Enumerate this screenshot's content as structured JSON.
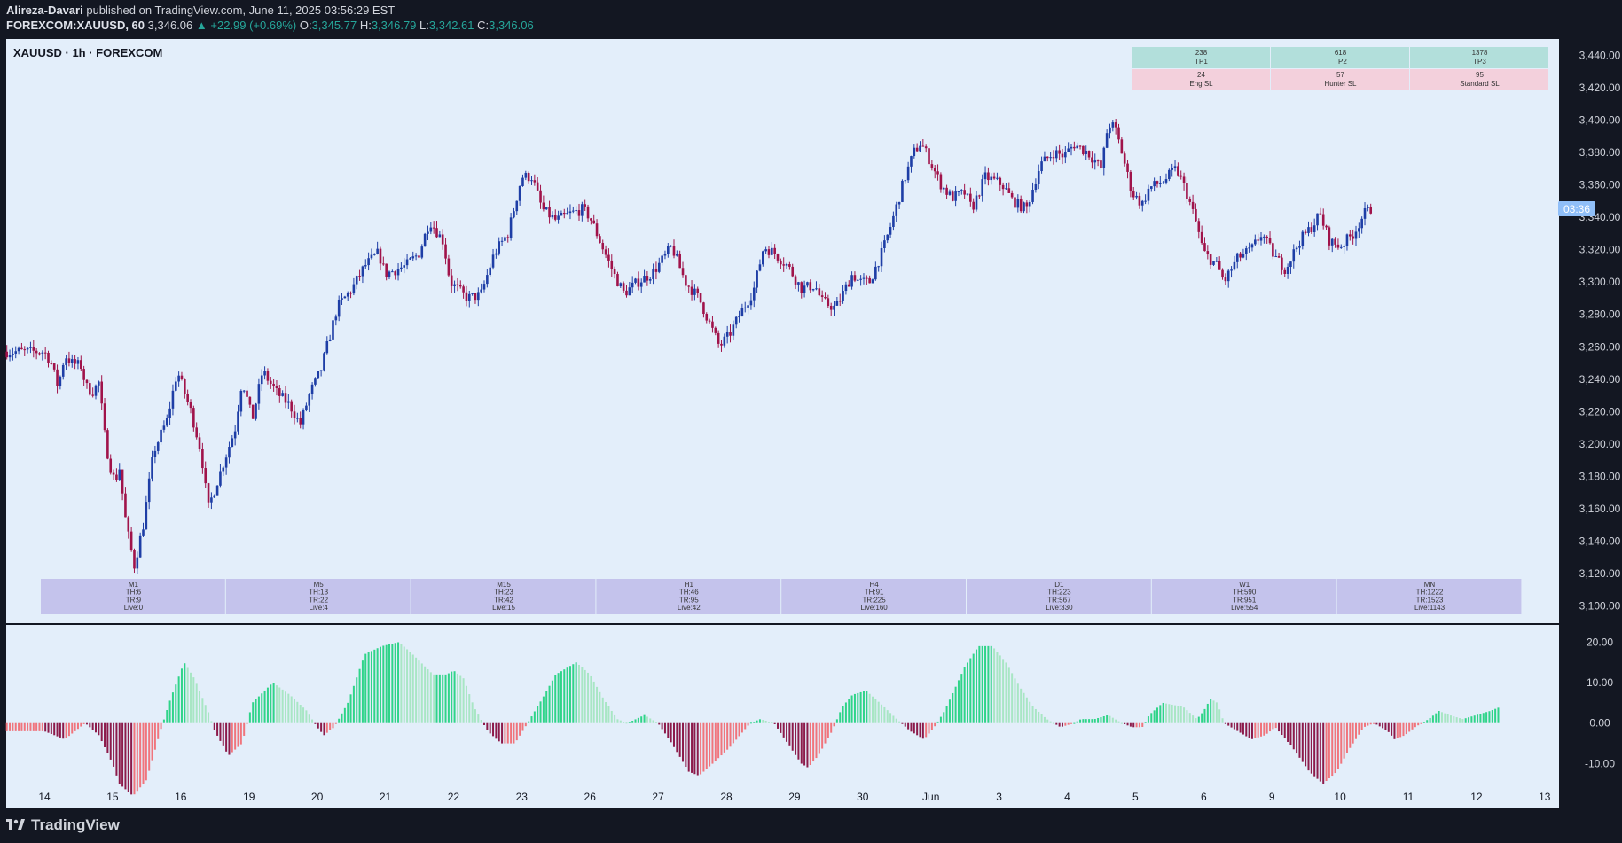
{
  "header": {
    "author": "Alireza-Davari",
    "published": "published on TradingView.com, June 11, 2025 03:56:29 EST",
    "symbol": "FOREXCOM:XAUUSD, 60",
    "last": "3,346.06",
    "change": "▲ +22.99 (+0.69%)",
    "o_label": "O:",
    "o": "3,345.77",
    "h_label": "H:",
    "h": "3,346.79",
    "l_label": "L:",
    "l": "3,342.61",
    "c_label": "C:",
    "c": "3,346.06"
  },
  "legend_title": "XAUUSD · 1h · FOREXCOM",
  "price_badge": "03:36",
  "footer": {
    "brand": "TradingView"
  },
  "colors": {
    "background": "#131722",
    "plot_bg": "#e3eefa",
    "candle_up": "#1e3ea6",
    "candle_down": "#a0134a",
    "osc_pos_strong": "#2fd489",
    "osc_pos_weak": "#a8e6c4",
    "osc_neg_strong": "#8c1a4a",
    "osc_neg_weak": "#f0747c",
    "tp_fill": "#b2dfdb",
    "sl_fill": "#f3d0dc",
    "tf_fill": "#c4c3ec",
    "badge": "#90bff9"
  },
  "tp_sl_table": {
    "tp": [
      {
        "value": "238",
        "label": "TP1"
      },
      {
        "value": "618",
        "label": "TP2"
      },
      {
        "value": "1378",
        "label": "TP3"
      }
    ],
    "sl": [
      {
        "value": "24",
        "label": "Eng SL"
      },
      {
        "value": "57",
        "label": "Hunter SL"
      },
      {
        "value": "95",
        "label": "Standard SL"
      }
    ]
  },
  "timeframe_table": [
    {
      "tf": "M1",
      "th": "TH:6",
      "tr": "TR:9",
      "live": "Live:0"
    },
    {
      "tf": "M5",
      "th": "TH:13",
      "tr": "TR:22",
      "live": "Live:4"
    },
    {
      "tf": "M15",
      "th": "TH:23",
      "tr": "TR:42",
      "live": "Live:15"
    },
    {
      "tf": "H1",
      "th": "TH:46",
      "tr": "TR:95",
      "live": "Live:42"
    },
    {
      "tf": "H4",
      "th": "TH:91",
      "tr": "TR:225",
      "live": "Live:160"
    },
    {
      "tf": "D1",
      "th": "TH:223",
      "tr": "TR:567",
      "live": "Live:330"
    },
    {
      "tf": "W1",
      "th": "TH:590",
      "tr": "TR:951",
      "live": "Live:554"
    },
    {
      "tf": "MN",
      "th": "TH:1222",
      "tr": "TR:1523",
      "live": "Live:1143"
    }
  ],
  "chart_data": [
    {
      "type": "candlestick",
      "title": "XAUUSD · 1h · FOREXCOM",
      "ylim": [
        3090,
        3450
      ],
      "y_ticks": [
        3100,
        3120,
        3140,
        3160,
        3180,
        3200,
        3220,
        3240,
        3260,
        3280,
        3300,
        3320,
        3340,
        3360,
        3380,
        3400,
        3420,
        3440
      ],
      "y_tick_labels": [
        "3,100.00",
        "3,120.00",
        "3,140.00",
        "3,160.00",
        "3,180.00",
        "3,200.00",
        "3,220.00",
        "3,240.00",
        "3,260.00",
        "3,280.00",
        "3,300.00",
        "3,320.00",
        "3,340.00",
        "3,360.00",
        "3,380.00",
        "3,400.00",
        "3,420.00",
        "3,440.00"
      ],
      "x_labels": [
        "14",
        "15",
        "16",
        "19",
        "20",
        "21",
        "22",
        "23",
        "26",
        "27",
        "28",
        "29",
        "30",
        "Jun",
        "3",
        "4",
        "5",
        "6",
        "9",
        "10",
        "11",
        "12",
        "13"
      ],
      "x_label_pos": [
        0,
        1,
        2,
        3,
        4,
        5,
        6,
        7,
        8,
        9,
        10,
        11,
        12,
        13,
        14,
        15,
        16,
        17,
        18,
        19,
        20,
        21,
        22
      ],
      "bar_count_span": 22.5,
      "x_start": -0.55,
      "close_path": [
        [
          0,
          3257
        ],
        [
          0.1,
          3250
        ],
        [
          0.2,
          3235
        ],
        [
          0.3,
          3255
        ],
        [
          0.4,
          3250
        ],
        [
          0.55,
          3248
        ],
        [
          0.6,
          3236
        ],
        [
          0.7,
          3232
        ],
        [
          0.8,
          3238
        ],
        [
          0.9,
          3200
        ],
        [
          1.0,
          3180
        ],
        [
          1.05,
          3178
        ],
        [
          1.1,
          3186
        ],
        [
          1.2,
          3150
        ],
        [
          1.32,
          3125
        ],
        [
          1.45,
          3150
        ],
        [
          1.6,
          3195
        ],
        [
          1.8,
          3215
        ],
        [
          1.95,
          3245
        ],
        [
          2.15,
          3220
        ],
        [
          2.3,
          3195
        ],
        [
          2.4,
          3160
        ],
        [
          2.6,
          3185
        ],
        [
          2.8,
          3210
        ],
        [
          2.9,
          3240
        ],
        [
          3.05,
          3215
        ],
        [
          3.2,
          3245
        ],
        [
          3.4,
          3232
        ],
        [
          3.6,
          3224
        ],
        [
          3.75,
          3212
        ],
        [
          3.9,
          3232
        ],
        [
          4.05,
          3245
        ],
        [
          4.3,
          3285
        ],
        [
          4.5,
          3295
        ],
        [
          4.7,
          3310
        ],
        [
          4.9,
          3318
        ],
        [
          5.0,
          3305
        ],
        [
          5.3,
          3310
        ],
        [
          5.5,
          3318
        ],
        [
          5.65,
          3338
        ],
        [
          5.85,
          3325
        ],
        [
          5.95,
          3300
        ],
        [
          6.2,
          3290
        ],
        [
          6.4,
          3292
        ],
        [
          6.6,
          3318
        ],
        [
          6.8,
          3330
        ],
        [
          7.0,
          3365
        ],
        [
          7.15,
          3365
        ],
        [
          7.3,
          3345
        ],
        [
          7.5,
          3338
        ],
        [
          7.7,
          3342
        ],
        [
          7.9,
          3345
        ],
        [
          8.0,
          3340
        ],
        [
          8.15,
          3325
        ],
        [
          8.35,
          3305
        ],
        [
          8.5,
          3293
        ],
        [
          8.7,
          3300
        ],
        [
          8.9,
          3305
        ],
        [
          9.0,
          3310
        ],
        [
          9.2,
          3322
        ],
        [
          9.4,
          3300
        ],
        [
          9.6,
          3290
        ],
        [
          9.8,
          3270
        ],
        [
          9.9,
          3260
        ],
        [
          10.05,
          3268
        ],
        [
          10.2,
          3280
        ],
        [
          10.4,
          3295
        ],
        [
          10.55,
          3322
        ],
        [
          10.7,
          3318
        ],
        [
          10.9,
          3310
        ],
        [
          11.1,
          3296
        ],
        [
          11.3,
          3298
        ],
        [
          11.4,
          3288
        ],
        [
          11.6,
          3284
        ],
        [
          11.7,
          3292
        ],
        [
          11.85,
          3305
        ],
        [
          11.95,
          3300
        ],
        [
          12.1,
          3300
        ],
        [
          12.3,
          3320
        ],
        [
          12.45,
          3340
        ],
        [
          12.6,
          3362
        ],
        [
          12.75,
          3380
        ],
        [
          12.85,
          3386
        ],
        [
          12.95,
          3378
        ],
        [
          13.15,
          3360
        ],
        [
          13.3,
          3352
        ],
        [
          13.5,
          3355
        ],
        [
          13.6,
          3345
        ],
        [
          13.8,
          3365
        ],
        [
          14.05,
          3360
        ],
        [
          14.2,
          3350
        ],
        [
          14.4,
          3345
        ],
        [
          14.6,
          3372
        ],
        [
          14.8,
          3380
        ],
        [
          14.95,
          3378
        ],
        [
          15.1,
          3385
        ],
        [
          15.3,
          3380
        ],
        [
          15.5,
          3370
        ],
        [
          15.6,
          3398
        ],
        [
          15.7,
          3395
        ],
        [
          15.8,
          3380
        ],
        [
          15.95,
          3355
        ],
        [
          16.1,
          3348
        ],
        [
          16.2,
          3358
        ],
        [
          16.4,
          3362
        ],
        [
          16.6,
          3370
        ],
        [
          16.75,
          3355
        ],
        [
          16.9,
          3335
        ],
        [
          17.0,
          3318
        ],
        [
          17.2,
          3310
        ],
        [
          17.3,
          3300
        ],
        [
          17.5,
          3315
        ],
        [
          17.7,
          3320
        ],
        [
          17.85,
          3330
        ],
        [
          18.05,
          3315
        ],
        [
          18.2,
          3308
        ],
        [
          18.4,
          3325
        ],
        [
          18.6,
          3335
        ],
        [
          18.7,
          3342
        ],
        [
          18.85,
          3325
        ],
        [
          19.0,
          3322
        ],
        [
          19.2,
          3330
        ],
        [
          19.35,
          3342
        ],
        [
          19.45,
          3345
        ]
      ]
    },
    {
      "type": "bar",
      "name": "oscillator",
      "ylim": [
        -18,
        24
      ],
      "y_ticks": [
        -10,
        0,
        10,
        20
      ],
      "y_tick_labels": [
        "-10.00",
        "0.00",
        "10.00",
        "20.00"
      ],
      "values_path": [
        [
          0,
          -2
        ],
        [
          0.3,
          -4
        ],
        [
          0.6,
          0
        ],
        [
          0.8,
          -3
        ],
        [
          1.0,
          -10
        ],
        [
          1.1,
          -15
        ],
        [
          1.3,
          -18
        ],
        [
          1.5,
          -14
        ],
        [
          1.7,
          -2
        ],
        [
          1.85,
          6
        ],
        [
          2.05,
          15
        ],
        [
          2.2,
          11
        ],
        [
          2.4,
          3
        ],
        [
          2.5,
          -2
        ],
        [
          2.7,
          -8
        ],
        [
          2.9,
          -5
        ],
        [
          3.05,
          5
        ],
        [
          3.35,
          10
        ],
        [
          3.6,
          7
        ],
        [
          3.85,
          3
        ],
        [
          4.0,
          -1
        ],
        [
          4.1,
          -3
        ],
        [
          4.25,
          -1
        ],
        [
          4.45,
          5
        ],
        [
          4.7,
          17
        ],
        [
          4.95,
          19
        ],
        [
          5.2,
          20
        ],
        [
          5.4,
          17
        ],
        [
          5.7,
          12
        ],
        [
          5.9,
          12
        ],
        [
          6.0,
          13
        ],
        [
          6.15,
          11
        ],
        [
          6.3,
          4
        ],
        [
          6.5,
          -2
        ],
        [
          6.7,
          -5
        ],
        [
          6.9,
          -5
        ],
        [
          7.05,
          -1
        ],
        [
          7.3,
          6
        ],
        [
          7.5,
          12
        ],
        [
          7.8,
          15
        ],
        [
          8.0,
          12
        ],
        [
          8.2,
          6
        ],
        [
          8.4,
          1
        ],
        [
          8.55,
          0
        ],
        [
          8.8,
          2
        ],
        [
          9.0,
          0
        ],
        [
          9.2,
          -5
        ],
        [
          9.45,
          -12
        ],
        [
          9.6,
          -13
        ],
        [
          9.8,
          -10
        ],
        [
          10.05,
          -6
        ],
        [
          10.2,
          -3
        ],
        [
          10.35,
          0
        ],
        [
          10.5,
          1
        ],
        [
          10.7,
          0
        ],
        [
          10.9,
          -5
        ],
        [
          11.1,
          -10
        ],
        [
          11.2,
          -11
        ],
        [
          11.35,
          -8
        ],
        [
          11.55,
          -2
        ],
        [
          11.7,
          4
        ],
        [
          11.85,
          7
        ],
        [
          12.05,
          8
        ],
        [
          12.25,
          5
        ],
        [
          12.5,
          1
        ],
        [
          12.7,
          -2
        ],
        [
          12.9,
          -4
        ],
        [
          13.05,
          -1
        ],
        [
          13.2,
          3
        ],
        [
          13.5,
          14
        ],
        [
          13.7,
          19
        ],
        [
          13.9,
          19
        ],
        [
          14.1,
          15
        ],
        [
          14.3,
          9
        ],
        [
          14.5,
          4
        ],
        [
          14.7,
          1
        ],
        [
          14.9,
          -1
        ],
        [
          15.1,
          0
        ],
        [
          15.2,
          1
        ],
        [
          15.4,
          1
        ],
        [
          15.6,
          2
        ],
        [
          15.8,
          0
        ],
        [
          15.95,
          -1
        ],
        [
          16.1,
          -1
        ],
        [
          16.2,
          2
        ],
        [
          16.4,
          5
        ],
        [
          16.7,
          4
        ],
        [
          16.9,
          1
        ],
        [
          17.0,
          3
        ],
        [
          17.1,
          6
        ],
        [
          17.2,
          5
        ],
        [
          17.3,
          0
        ],
        [
          17.5,
          -2
        ],
        [
          17.7,
          -4
        ],
        [
          17.9,
          -3
        ],
        [
          18.05,
          -1
        ],
        [
          18.3,
          -6
        ],
        [
          18.55,
          -12
        ],
        [
          18.75,
          -15
        ],
        [
          18.95,
          -12
        ],
        [
          19.15,
          -6
        ],
        [
          19.35,
          -1
        ],
        [
          19.5,
          0
        ],
        [
          19.7,
          -2
        ],
        [
          19.8,
          -4
        ],
        [
          19.95,
          -3
        ],
        [
          20.1,
          -1
        ],
        [
          20.3,
          1
        ],
        [
          20.45,
          3
        ],
        [
          20.6,
          2
        ],
        [
          20.8,
          1
        ],
        [
          21.0,
          2
        ],
        [
          21.2,
          3
        ],
        [
          21.35,
          4
        ]
      ]
    }
  ]
}
